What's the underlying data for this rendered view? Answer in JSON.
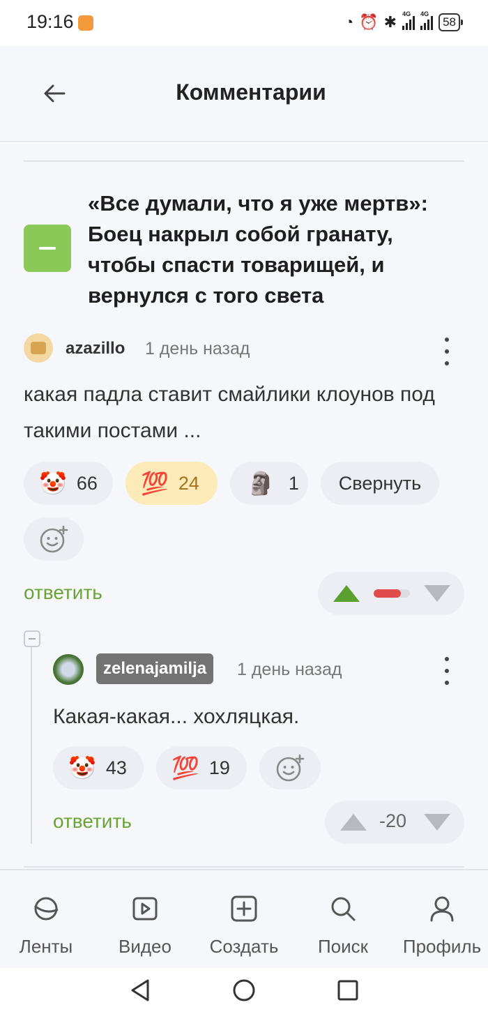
{
  "status_bar": {
    "time": "19:16",
    "icons": [
      "speed-icon",
      "alarm-icon",
      "bluetooth-icon",
      "signal-4g-icon",
      "signal-4g-icon"
    ],
    "network_label": "4G",
    "battery": "58"
  },
  "header": {
    "title": "Комментарии",
    "back_icon": "arrow-left-icon"
  },
  "post": {
    "title": "«Все думали, что я уже мертв»: Боец накрыл собой гранату, чтобы спасти товарищей, и вернулся с того света"
  },
  "comments": [
    {
      "username": "azazillo",
      "time": "1 день назад",
      "text": "какая падла ставит смайлики клоунов под такими постами ...",
      "reactions": [
        {
          "emoji": "🤡",
          "count": "66",
          "active": false
        },
        {
          "emoji": "💯",
          "count": "24",
          "active": true
        },
        {
          "emoji": "🗿",
          "count": "1",
          "active": false
        }
      ],
      "collapse_label": "Свернуть",
      "reply_label": "ответить",
      "rating_fraction_negative": 0.75
    },
    {
      "username": "zelenajamilja",
      "time": "1 день назад",
      "text": "Какая-какая... хохляцкая.",
      "reactions": [
        {
          "emoji": "🤡",
          "count": "43",
          "active": false
        },
        {
          "emoji": "💯",
          "count": "19",
          "active": false
        }
      ],
      "reply_label": "ответить",
      "score": "-20"
    }
  ],
  "bottom_nav": [
    {
      "label": "Ленты",
      "icon": "feeds-icon"
    },
    {
      "label": "Видео",
      "icon": "video-icon"
    },
    {
      "label": "Создать",
      "icon": "plus-square-icon"
    },
    {
      "label": "Поиск",
      "icon": "search-icon"
    },
    {
      "label": "Профиль",
      "icon": "profile-icon"
    }
  ],
  "colors": {
    "accent_green": "#6aa336",
    "collapse_green": "#8ac858",
    "active_chip_bg": "#fcebb8",
    "negative_red": "#e24b4b"
  }
}
